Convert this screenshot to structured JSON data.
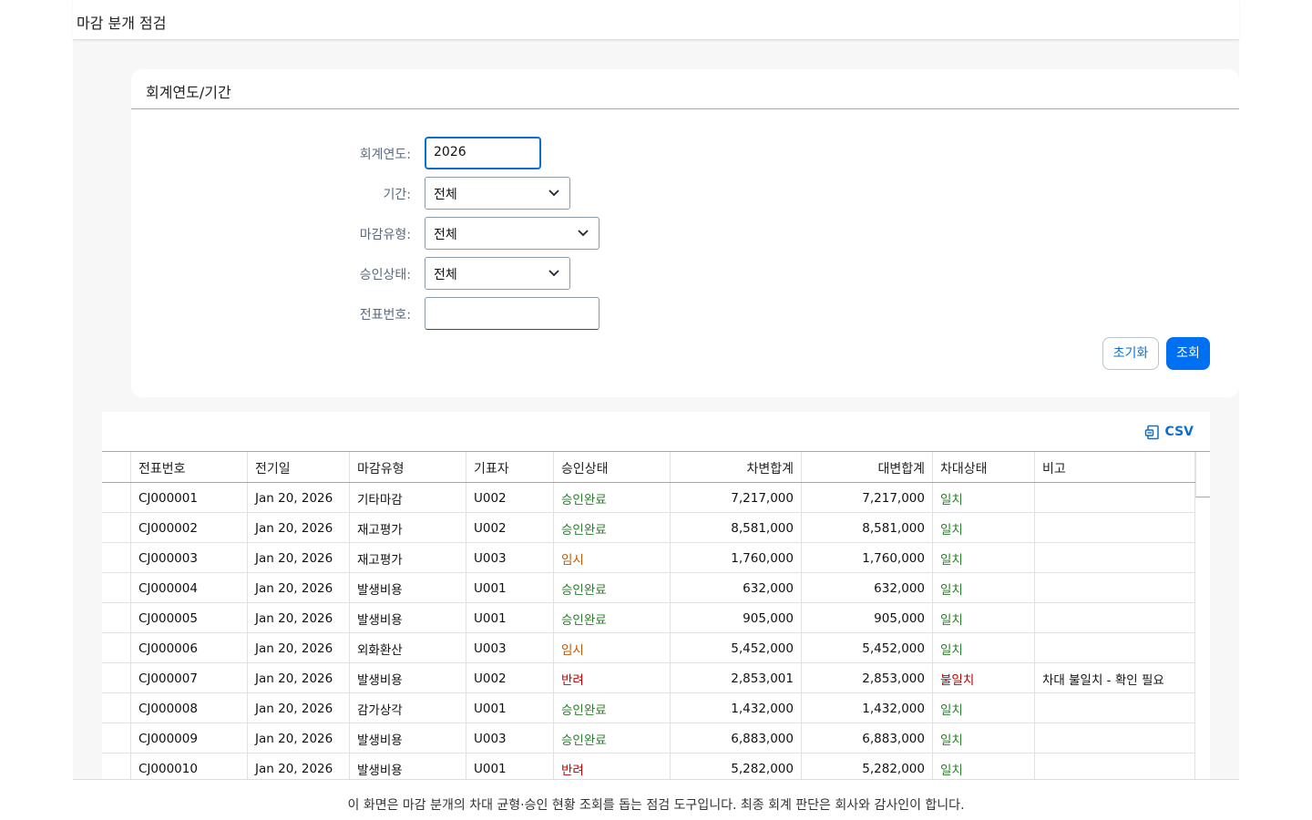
{
  "header": {
    "title": "마감 분개 점검"
  },
  "filter": {
    "section_title": "회계연도/기간",
    "fiscal_year_label": "회계연도:",
    "fiscal_year_value": "2026",
    "period_label": "기간:",
    "period_value": "전체",
    "closing_type_label": "마감유형:",
    "closing_type_value": "전체",
    "approval_label": "승인상태:",
    "approval_value": "전체",
    "voucher_label": "전표번호:",
    "voucher_value": "",
    "reset_label": "초기화",
    "search_label": "조회"
  },
  "table": {
    "csv_label": "CSV",
    "columns": [
      "전표번호",
      "전기일",
      "마감유형",
      "기표자",
      "승인상태",
      "차변합계",
      "대변합계",
      "차대상태",
      "비고"
    ],
    "rows": [
      [
        "CJ000001",
        "Jan 20, 2026",
        "기타마감",
        "U002",
        "승인완료",
        "7,217,000",
        "7,217,000",
        "일치",
        ""
      ],
      [
        "CJ000002",
        "Jan 20, 2026",
        "재고평가",
        "U002",
        "승인완료",
        "8,581,000",
        "8,581,000",
        "일치",
        ""
      ],
      [
        "CJ000003",
        "Jan 20, 2026",
        "재고평가",
        "U003",
        "임시",
        "1,760,000",
        "1,760,000",
        "일치",
        ""
      ],
      [
        "CJ000004",
        "Jan 20, 2026",
        "발생비용",
        "U001",
        "승인완료",
        "632,000",
        "632,000",
        "일치",
        ""
      ],
      [
        "CJ000005",
        "Jan 20, 2026",
        "발생비용",
        "U001",
        "승인완료",
        "905,000",
        "905,000",
        "일치",
        ""
      ],
      [
        "CJ000006",
        "Jan 20, 2026",
        "외화환산",
        "U003",
        "임시",
        "5,452,000",
        "5,452,000",
        "일치",
        ""
      ],
      [
        "CJ000007",
        "Jan 20, 2026",
        "발생비용",
        "U002",
        "반려",
        "2,853,001",
        "2,853,000",
        "불일치",
        "차대 불일치 - 확인 필요"
      ],
      [
        "CJ000008",
        "Jan 20, 2026",
        "감가상각",
        "U001",
        "승인완료",
        "1,432,000",
        "1,432,000",
        "일치",
        ""
      ],
      [
        "CJ000009",
        "Jan 20, 2026",
        "발생비용",
        "U003",
        "승인완료",
        "6,883,000",
        "6,883,000",
        "일치",
        ""
      ],
      [
        "CJ000010",
        "Jan 20, 2026",
        "발생비용",
        "U001",
        "반려",
        "5,282,000",
        "5,282,000",
        "일치",
        ""
      ]
    ]
  },
  "footer": {
    "text": "이 화면은 마감 분개의 차대 균형·승인 현황 조회를 돕는 점검 도구입니다. 최종 회계 판단은 회사와 감사인이 합니다."
  },
  "colors": {
    "primary": "#0070f2",
    "ok": "#2b7d2b",
    "temp": "#c35500",
    "rejected": "#bb0000"
  },
  "icons": {
    "csv": "export-document-icon",
    "dropdown": "chevron-down-icon"
  }
}
